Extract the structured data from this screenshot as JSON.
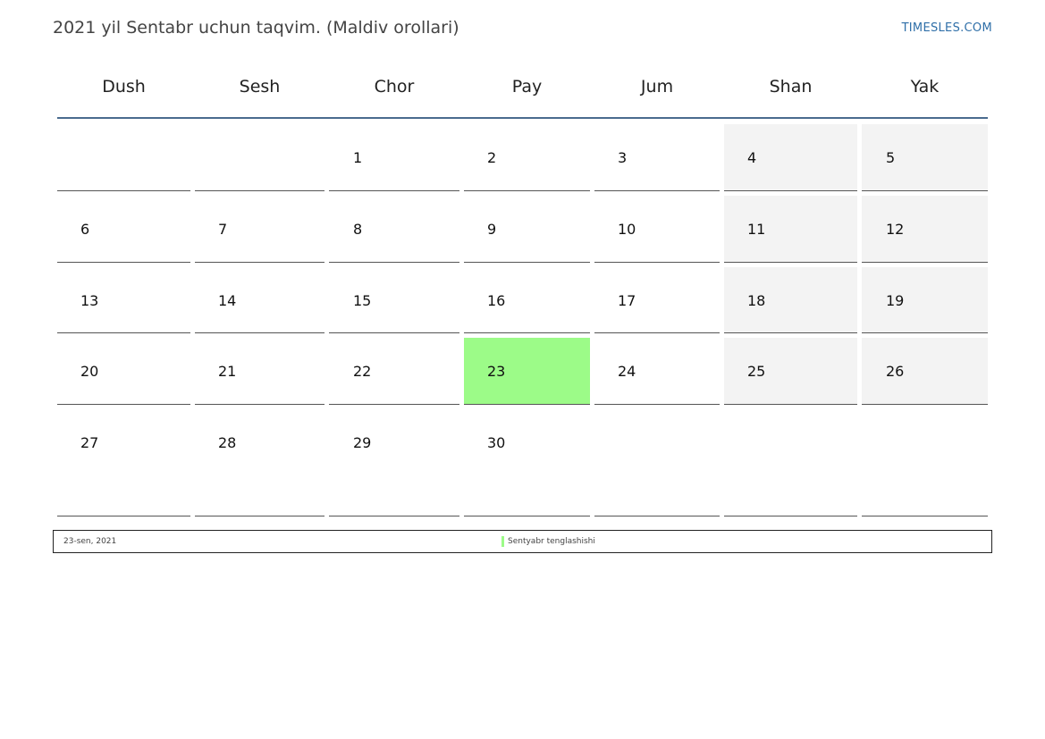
{
  "header": {
    "title": "2021 yil Sentabr uchun taqvim. (Maldiv orollari)",
    "site": "TIMESLES.COM"
  },
  "weekdays": [
    "Dush",
    "Sesh",
    "Chor",
    "Pay",
    "Jum",
    "Shan",
    "Yak"
  ],
  "weeks": [
    [
      "",
      "",
      "1",
      "2",
      "3",
      "4",
      "5"
    ],
    [
      "6",
      "7",
      "8",
      "9",
      "10",
      "11",
      "12"
    ],
    [
      "13",
      "14",
      "15",
      "16",
      "17",
      "18",
      "19"
    ],
    [
      "20",
      "21",
      "22",
      "23",
      "24",
      "25",
      "26"
    ],
    [
      "27",
      "28",
      "29",
      "30",
      "",
      "",
      ""
    ]
  ],
  "holiday_day": "23",
  "legend": {
    "date": "23-sen, 2021",
    "name": "Sentyabr tenglashishi"
  },
  "colors": {
    "holiday": "#9cfb88",
    "weekend": "#f3f3f3",
    "header_rule": "#4a6b8e",
    "link": "#2f6fa8"
  }
}
